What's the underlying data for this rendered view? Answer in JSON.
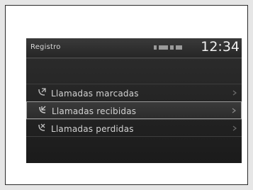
{
  "header": {
    "title": "Registro",
    "time": "12:34",
    "status_icons": [
      "signal-icon",
      "bluetooth-icon",
      "battery-icon",
      "phone-icon"
    ]
  },
  "menu": {
    "items": [
      {
        "label": "Llamadas marcadas",
        "icon": "outgoing-call-icon",
        "selected": false
      },
      {
        "label": "Llamadas recibidas",
        "icon": "incoming-call-icon",
        "selected": true
      },
      {
        "label": "Llamadas perdidas",
        "icon": "missed-call-icon",
        "selected": false
      }
    ]
  },
  "colors": {
    "screen_bg": "#1e1e1e",
    "text": "#d2d2d2",
    "selection_border": "#9b9b9b"
  }
}
